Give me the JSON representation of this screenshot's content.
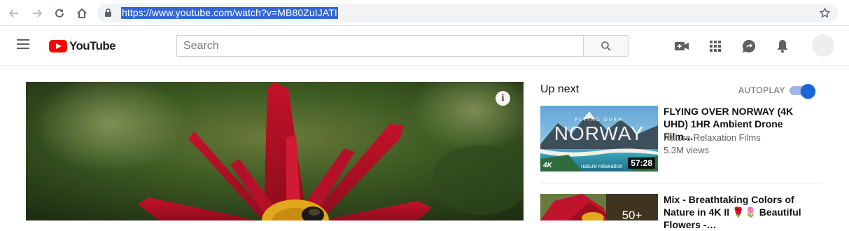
{
  "browser": {
    "url": "https://www.youtube.com/watch?v=MB80ZuIJATI"
  },
  "masthead": {
    "logo_text": "YouTube",
    "search_placeholder": "Search"
  },
  "sidebar": {
    "up_next_label": "Up next",
    "autoplay_label": "AUTOPLAY",
    "autoplay_on": true,
    "videos": [
      {
        "title": "FLYING OVER NORWAY (4K UHD) 1HR Ambient Drone Film…",
        "channel": "Nature Relaxation Films",
        "views": "5.3M views",
        "duration": "57:28",
        "thumb_text": "NORWAY",
        "thumb_small_text": "FLYING OVER",
        "thumb_badge": "4K",
        "thumb_brand": "nature relaxation"
      },
      {
        "title": "Mix - Breathtaking Colors of Nature in 4K II 🌹🌷 Beautiful Flowers -…",
        "playlist_count": "50+"
      }
    ]
  },
  "player": {
    "info_icon_label": "i"
  },
  "colors": {
    "brand_red": "#ff0000",
    "url_highlight": "#3367d6",
    "toggle_blue": "#1a66d9"
  }
}
